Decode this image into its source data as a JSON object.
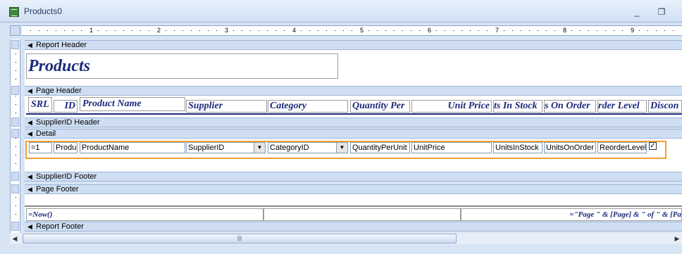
{
  "window": {
    "title": "Products0",
    "minimize": "_",
    "restore": "❐"
  },
  "ruler": {
    "marks": [
      "1",
      "2",
      "3",
      "4",
      "5",
      "6",
      "7",
      "8",
      "9"
    ]
  },
  "sections": {
    "report_header": "Report Header",
    "page_header": "Page Header",
    "supplier_header": "SupplierID Header",
    "detail": "Detail",
    "supplier_footer": "SupplierID Footer",
    "page_footer": "Page Footer",
    "report_footer": "Report Footer"
  },
  "report_title": "Products",
  "page_header_labels": [
    "SRL",
    "ID",
    "Product Name",
    "Supplier",
    "Category",
    "Quantity Per",
    "Unit Price",
    "ts In Stock",
    "s On Order",
    "rder Level",
    "Discon"
  ],
  "detail_fields": [
    "=1",
    "Produ",
    "ProductName",
    "SupplierID",
    "CategoryID",
    "QuantityPerUnit",
    "UnitPrice",
    "UnitsInStock",
    "UnitsOnOrder",
    "ReorderLevel"
  ],
  "page_footer": {
    "left": "=Now()",
    "right": "=\"Page \" & [Page] & \" of \" & [Pa"
  },
  "icons": {
    "section_arrow": "◀",
    "combo_arrow": "▼",
    "scroll_left": "◀",
    "scroll_right": "▶",
    "grip": "|||"
  }
}
